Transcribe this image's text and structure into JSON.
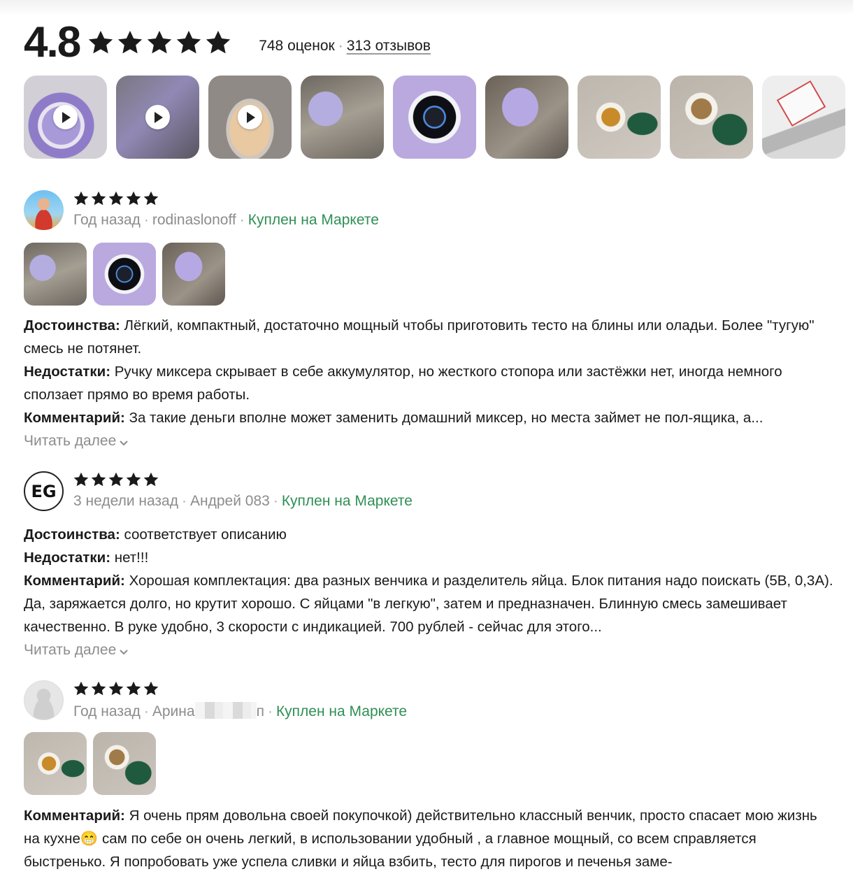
{
  "summary": {
    "rating": "4.8",
    "stars": 5,
    "ratings_count": "748 оценок",
    "separator": "·",
    "reviews_link": "313 отзывов"
  },
  "gallery": [
    {
      "video": true
    },
    {
      "video": true
    },
    {
      "video": true
    },
    {
      "video": false
    },
    {
      "video": false
    },
    {
      "video": false
    },
    {
      "video": false
    },
    {
      "video": false
    },
    {
      "video": false
    }
  ],
  "reviews": [
    {
      "stars": 5,
      "date": "Год назад",
      "author": "rodinaslonoff",
      "badge": "Куплен на Маркете",
      "pros_label": "Достоинства:",
      "pros": "Лёгкий, компактный, достаточно мощный чтобы приготовить тесто на блины или оладьи. Более \"тугую\" смесь не потянет.",
      "cons_label": "Недостатки:",
      "cons": "Ручку миксера скрывает в себе аккумулятор, но жесткого стопора или застёжки нет, иногда немного сползает прямо во время работы.",
      "comment_label": "Комментарий:",
      "comment": "За такие деньги вполне может заменить домашний миксер, но места займет не пол-ящика, а...",
      "read_more": "Читать далее"
    },
    {
      "stars": 5,
      "date": "3 недели назад",
      "author": "Андрей 083",
      "avatar_text": "EG",
      "badge": "Куплен на Маркете",
      "pros_label": "Достоинства:",
      "pros": "соответствует описанию",
      "cons_label": "Недостатки:",
      "cons": "нет!!!",
      "comment_label": "Комментарий:",
      "comment": "Хорошая комплектация: два разных венчика и разделитель яйца. Блок питания надо поискать (5В, 0,3А). Да, заряжается долго, но крутит хорошо. С яйцами \"в легкую\", затем и предназначен. Блинную смесь замешивает качественно. В руке удобно, 3 скорости с индикацией. 700 рублей - сейчас для этого...",
      "read_more": "Читать далее"
    },
    {
      "stars": 5,
      "date": "Год назад",
      "author": "Арина",
      "author_tail": "п",
      "badge": "Куплен на Маркете",
      "comment_label": "Комментарий:",
      "comment": "Я очень прям довольна своей покупочкой) действительно классный венчик, просто спасает мою жизнь на кухне😁 сам по себе он очень легкий, в использовании удобный , а главное мощный, со всем справляется быстренько. Я попробовать уже успела сливки и яйца взбить, тесто для пирогов и печенья заме-"
    }
  ],
  "meta_separator": "·"
}
